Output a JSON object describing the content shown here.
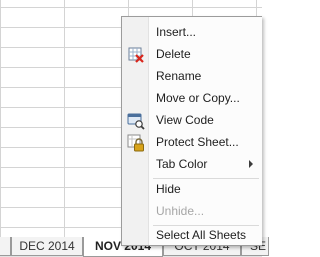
{
  "sheet_tabs": [
    {
      "label": "DEC 2014",
      "active": false
    },
    {
      "label": "NOV 2014",
      "active": true
    },
    {
      "label": "OCT 2014",
      "active": false
    },
    {
      "label": "SE",
      "active": false
    }
  ],
  "context_menu": {
    "items": [
      {
        "label": "Insert...",
        "disabled": false,
        "icon": null,
        "submenu": false
      },
      {
        "label": "Delete",
        "disabled": false,
        "icon": "delete-sheet-icon",
        "submenu": false
      },
      {
        "label": "Rename",
        "disabled": false,
        "icon": null,
        "submenu": false
      },
      {
        "label": "Move or Copy...",
        "disabled": false,
        "icon": null,
        "submenu": false
      },
      {
        "label": "View Code",
        "disabled": false,
        "icon": "view-code-icon",
        "submenu": false
      },
      {
        "label": "Protect Sheet...",
        "disabled": false,
        "icon": "protect-sheet-icon",
        "submenu": false
      },
      {
        "label": "Tab Color",
        "disabled": false,
        "icon": null,
        "submenu": true
      },
      {
        "label": "Hide",
        "disabled": false,
        "icon": null,
        "submenu": false
      },
      {
        "label": "Unhide...",
        "disabled": true,
        "icon": null,
        "submenu": false
      },
      {
        "label": "Select All Sheets",
        "disabled": false,
        "icon": null,
        "submenu": false
      }
    ]
  },
  "colors": {
    "delete_icon_red": "#d9261c",
    "lock_gold": "#d8a31a",
    "menu_text": "#1e1e1e",
    "disabled_text": "#a6a6a6"
  }
}
